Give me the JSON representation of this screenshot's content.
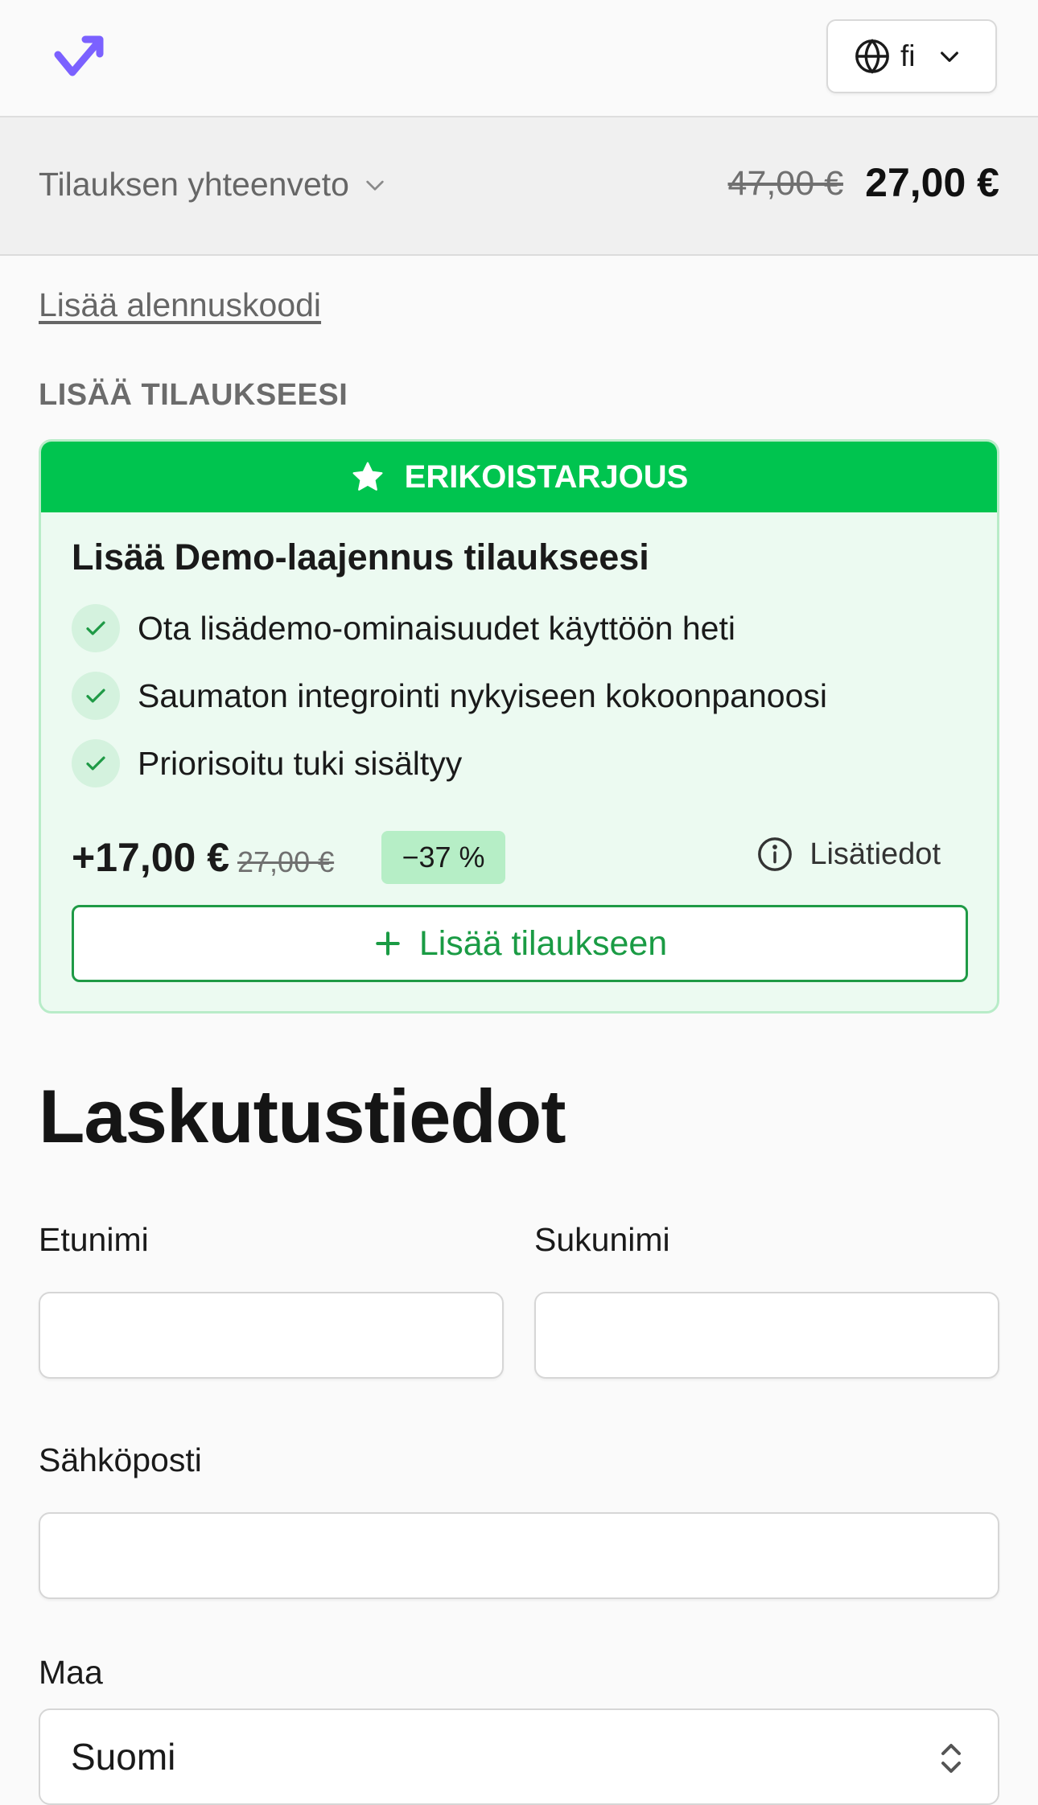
{
  "header": {
    "language": {
      "code": "fi"
    }
  },
  "summary": {
    "toggle_label": "Tilauksen yhteenveto",
    "original_total": "47,00 €",
    "total": "27,00 €"
  },
  "discount_link": "Lisää alennuskoodi",
  "upsell": {
    "section_label": "LISÄÄ TILAUKSEESI",
    "badge": "ERIKOISTARJOUS",
    "title": "Lisää Demo-laajennus tilaukseesi",
    "features": [
      "Ota lisädemo-ominaisuudet käyttöön heti",
      "Saumaton integrointi nykyiseen kokoonpanoosi",
      "Priorisoitu tuki sisältyy"
    ],
    "price": "+17,00 €",
    "original_price": "27,00 €",
    "discount": "−37 %",
    "info_label": "Lisätiedot",
    "add_button": "Lisää tilaukseen"
  },
  "billing": {
    "title": "Laskutustiedot",
    "first_name": {
      "label": "Etunimi",
      "value": ""
    },
    "last_name": {
      "label": "Sukunimi",
      "value": ""
    },
    "email": {
      "label": "Sähköposti",
      "value": ""
    },
    "country": {
      "label": "Maa",
      "value": "Suomi"
    }
  },
  "colors": {
    "brand": "#7b61ff",
    "offer_green": "#00c44f",
    "offer_bg": "#ecfaf1",
    "button_green": "#1a9b44"
  },
  "icons": [
    "checkmark-logo-icon",
    "globe-icon",
    "chevron-down-icon",
    "star-icon",
    "check-icon",
    "info-icon",
    "plus-icon",
    "updown-chevron-icon"
  ]
}
